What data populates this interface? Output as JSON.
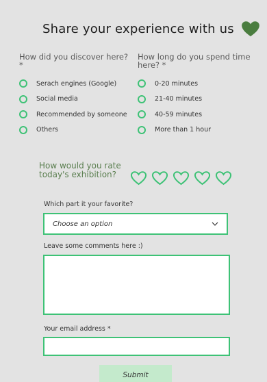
{
  "header": {
    "title": "Share your experience with us",
    "heart_color": "#4a7d3f"
  },
  "q1": {
    "label": "How did you discover here?",
    "required": "*",
    "options": [
      "Serach engines (Google)",
      "Social media",
      "Recommended by someone",
      "Others"
    ]
  },
  "q2": {
    "label": "How long do you spend time here? *",
    "options": [
      "0-20 minutes",
      "21-40 minutes",
      "40-59 minutes",
      "More than 1 hour"
    ]
  },
  "rating": {
    "label": "How would you rate today's exhibition?",
    "max": 5,
    "value": 0,
    "color": "#3ec276"
  },
  "favorite": {
    "label": "Which part it your favorite?",
    "value": "Choose an option"
  },
  "comments": {
    "label": "Leave some comments here :)",
    "value": ""
  },
  "email": {
    "label": "Your email address *",
    "value": ""
  },
  "submit": {
    "label": "Submit"
  },
  "accent": "#3ec276"
}
